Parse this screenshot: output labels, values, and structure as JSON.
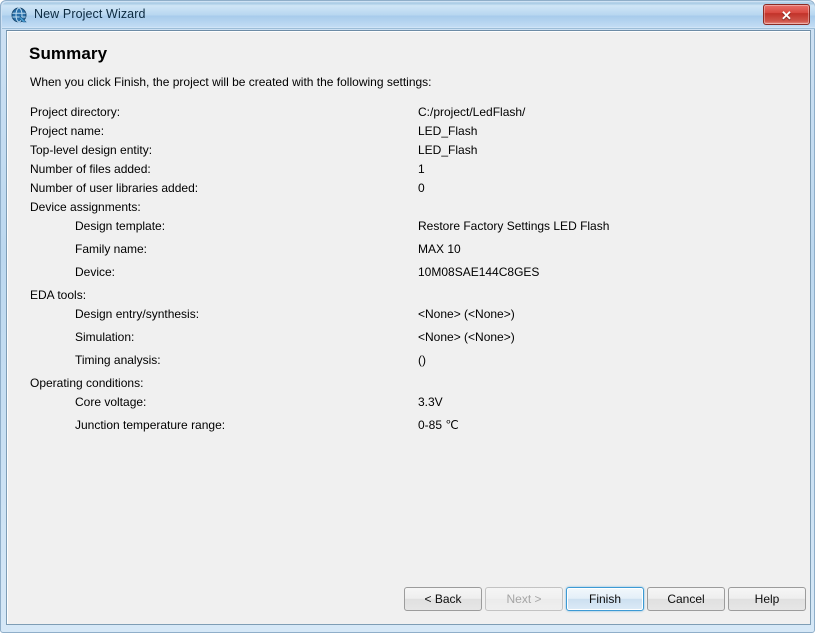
{
  "window": {
    "title": "New Project Wizard",
    "icon": "quartus-globe-icon",
    "close_label": "✕"
  },
  "page": {
    "title": "Summary",
    "intro": "When you click Finish, the project will be created with the following settings:"
  },
  "summary": {
    "rows": [
      {
        "label": "Project directory:",
        "value": "C:/project/LedFlash/",
        "indent": false
      },
      {
        "label": "Project name:",
        "value": "LED_Flash",
        "indent": false
      },
      {
        "label": "Top-level design entity:",
        "value": "LED_Flash",
        "indent": false
      },
      {
        "label": "Number of files added:",
        "value": "1",
        "indent": false
      },
      {
        "label": "Number of user libraries added:",
        "value": "0",
        "indent": false
      },
      {
        "label": "Device assignments:",
        "value": "",
        "indent": false
      },
      {
        "label": "Design template:",
        "value": "Restore Factory Settings LED Flash",
        "indent": true
      },
      {
        "label": "Family name:",
        "value": "MAX 10",
        "indent": true
      },
      {
        "label": "Device:",
        "value": "10M08SAE144C8GES",
        "indent": true
      },
      {
        "label": "EDA tools:",
        "value": "",
        "indent": false
      },
      {
        "label": "Design entry/synthesis:",
        "value": "<None> (<None>)",
        "indent": true
      },
      {
        "label": "Simulation:",
        "value": "<None> (<None>)",
        "indent": true
      },
      {
        "label": "Timing analysis:",
        "value": "()",
        "indent": true
      },
      {
        "label": "Operating conditions:",
        "value": "",
        "indent": false
      },
      {
        "label": "Core voltage:",
        "value": "3.3V",
        "indent": true
      },
      {
        "label": "Junction temperature range:",
        "value": "0-85 ℃",
        "indent": true
      }
    ]
  },
  "buttons": {
    "back": {
      "label": "< Back",
      "state": "enabled"
    },
    "next": {
      "label": "Next >",
      "state": "disabled"
    },
    "finish": {
      "label": "Finish",
      "state": "default"
    },
    "cancel": {
      "label": "Cancel",
      "state": "enabled"
    },
    "help": {
      "label": "Help",
      "state": "enabled"
    }
  },
  "colors": {
    "titlebar_blue": "#b6d6f0",
    "close_red": "#c13229",
    "default_button_focus": "#3c9ad4",
    "client_background": "#f0f0f0"
  }
}
